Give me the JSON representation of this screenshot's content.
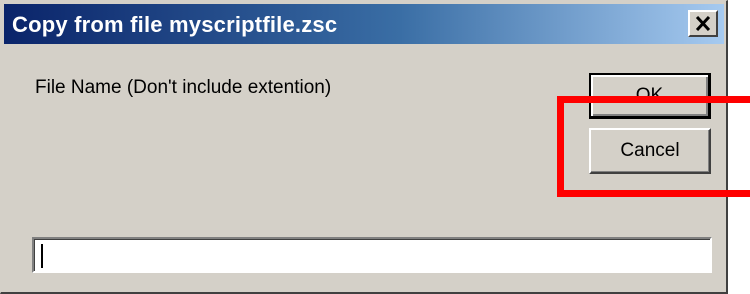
{
  "window": {
    "title": "Copy from file myscriptfile.zsc",
    "close_glyph": "✕"
  },
  "form": {
    "label": "File Name (Don't include extention)",
    "input_value": ""
  },
  "buttons": {
    "ok_label": "OK",
    "cancel_label": "Cancel"
  },
  "annotation": {
    "color": "#ff0000"
  },
  "colors": {
    "dialog_bg": "#d4d0c8",
    "title_start": "#0a246a",
    "title_end": "#a6caf0"
  }
}
